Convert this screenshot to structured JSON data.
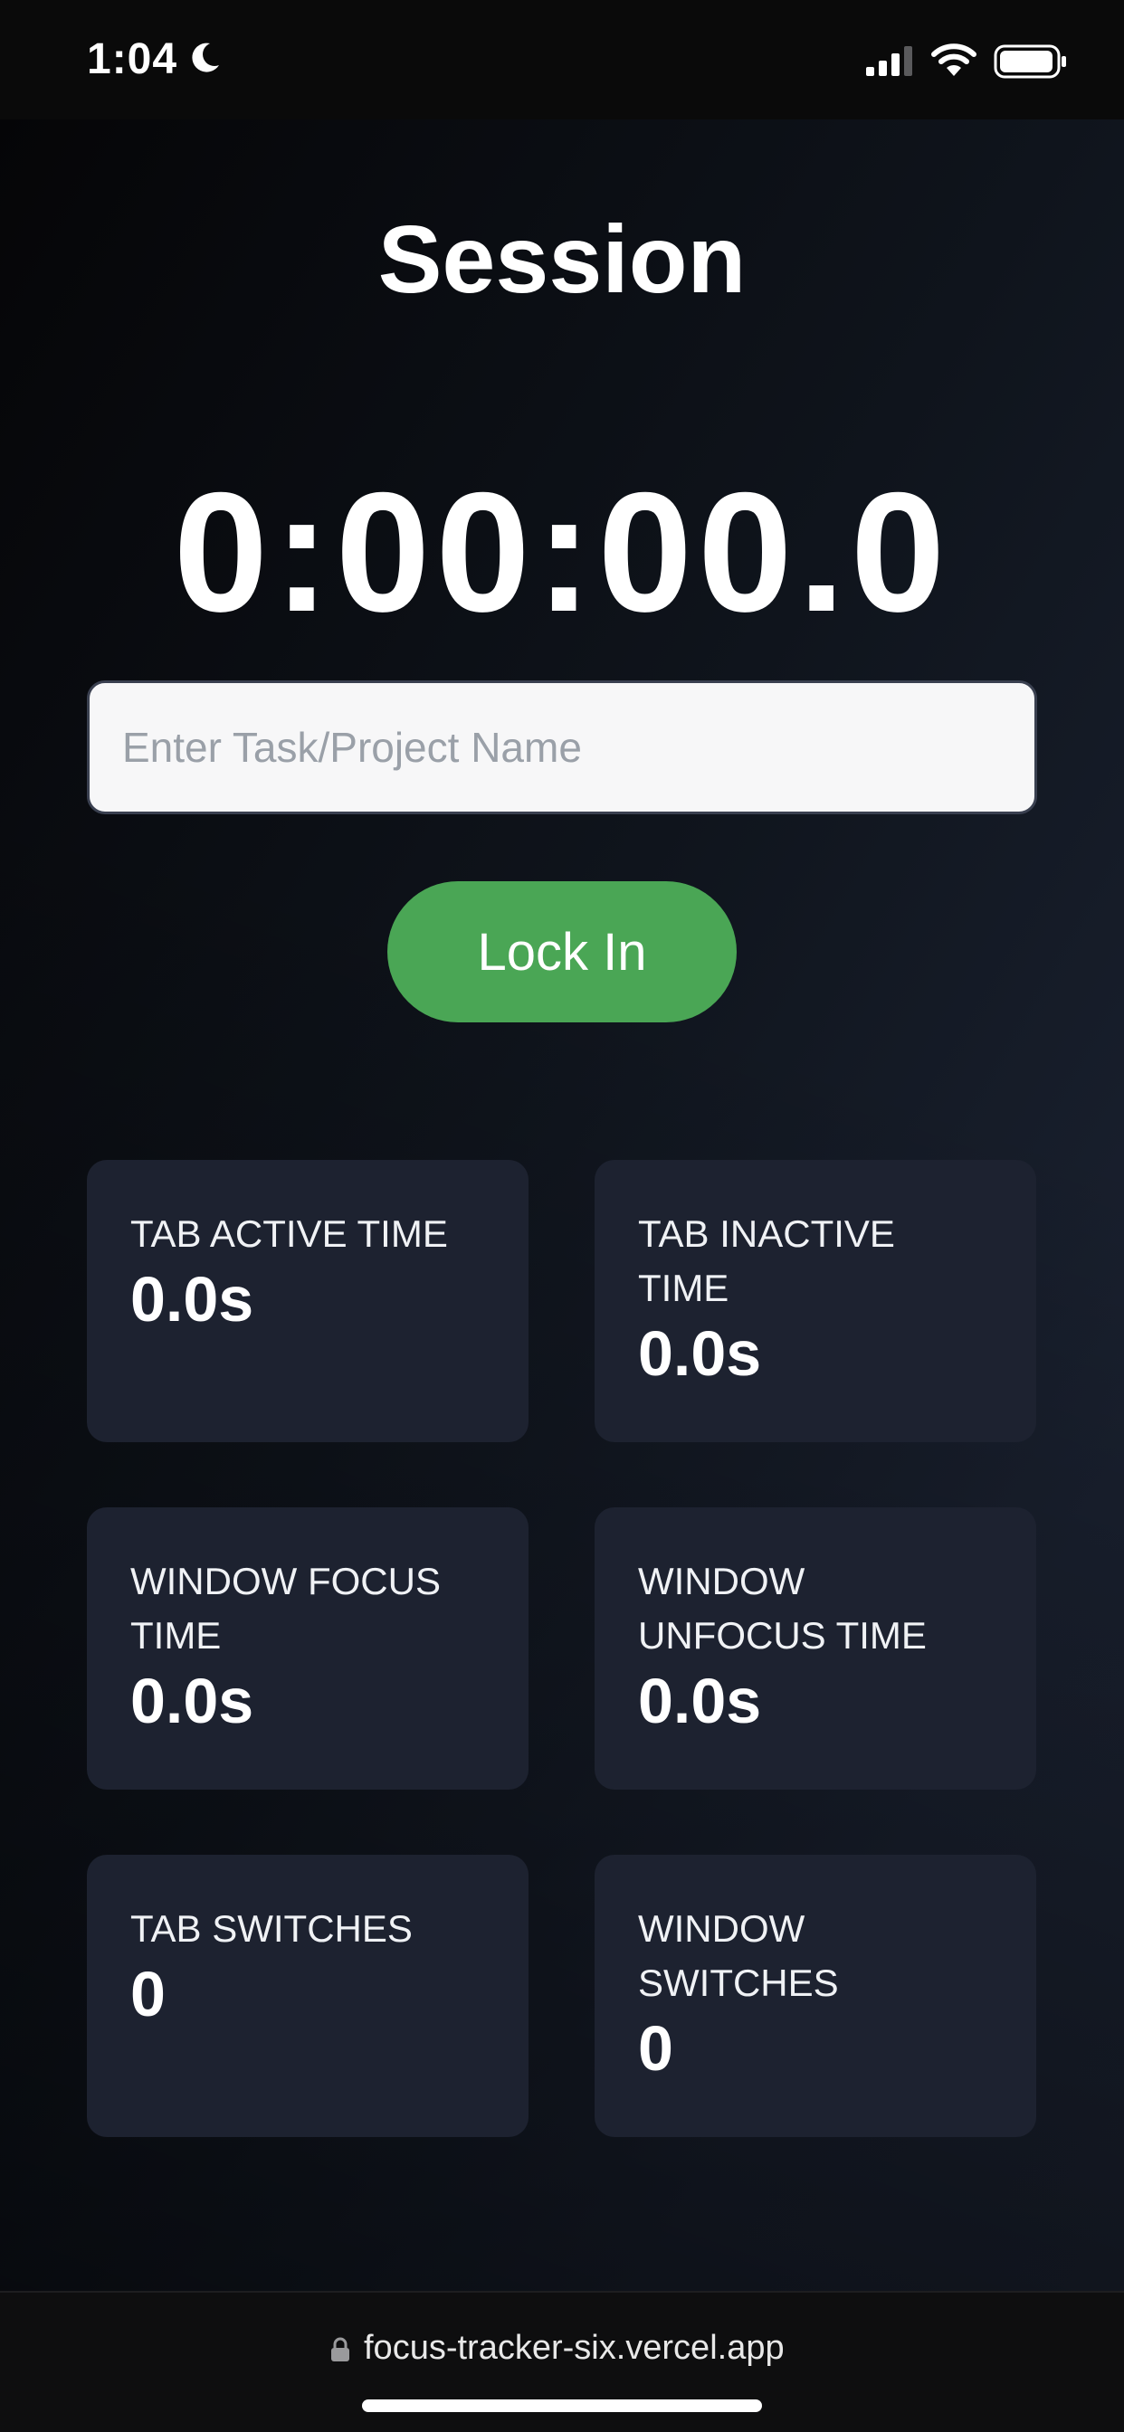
{
  "status_bar": {
    "time": "1:04"
  },
  "page": {
    "title": "Session",
    "timer": "0:00:00.0"
  },
  "task_input": {
    "value": "",
    "placeholder": "Enter Task/Project Name"
  },
  "lock_button": {
    "label": "Lock In"
  },
  "stats": [
    {
      "label": "TAB ACTIVE TIME",
      "value": "0.0s"
    },
    {
      "label": "TAB INACTIVE TIME",
      "value": "0.0s"
    },
    {
      "label": "WINDOW FOCUS TIME",
      "value": "0.0s"
    },
    {
      "label": "WINDOW UNFOCUS TIME",
      "value": "0.0s"
    },
    {
      "label": "TAB SWITCHES",
      "value": "0"
    },
    {
      "label": "WINDOW SWITCHES",
      "value": "0"
    }
  ],
  "browser": {
    "url": "focus-tracker-six.vercel.app"
  },
  "colors": {
    "accent_button": "#4aa655",
    "card_background": "#1d2230",
    "page_background": "#0f141c"
  },
  "icons": {
    "status": [
      "moon-icon",
      "signal-icon",
      "wifi-icon",
      "battery-icon"
    ],
    "browser": [
      "lock-icon"
    ]
  }
}
